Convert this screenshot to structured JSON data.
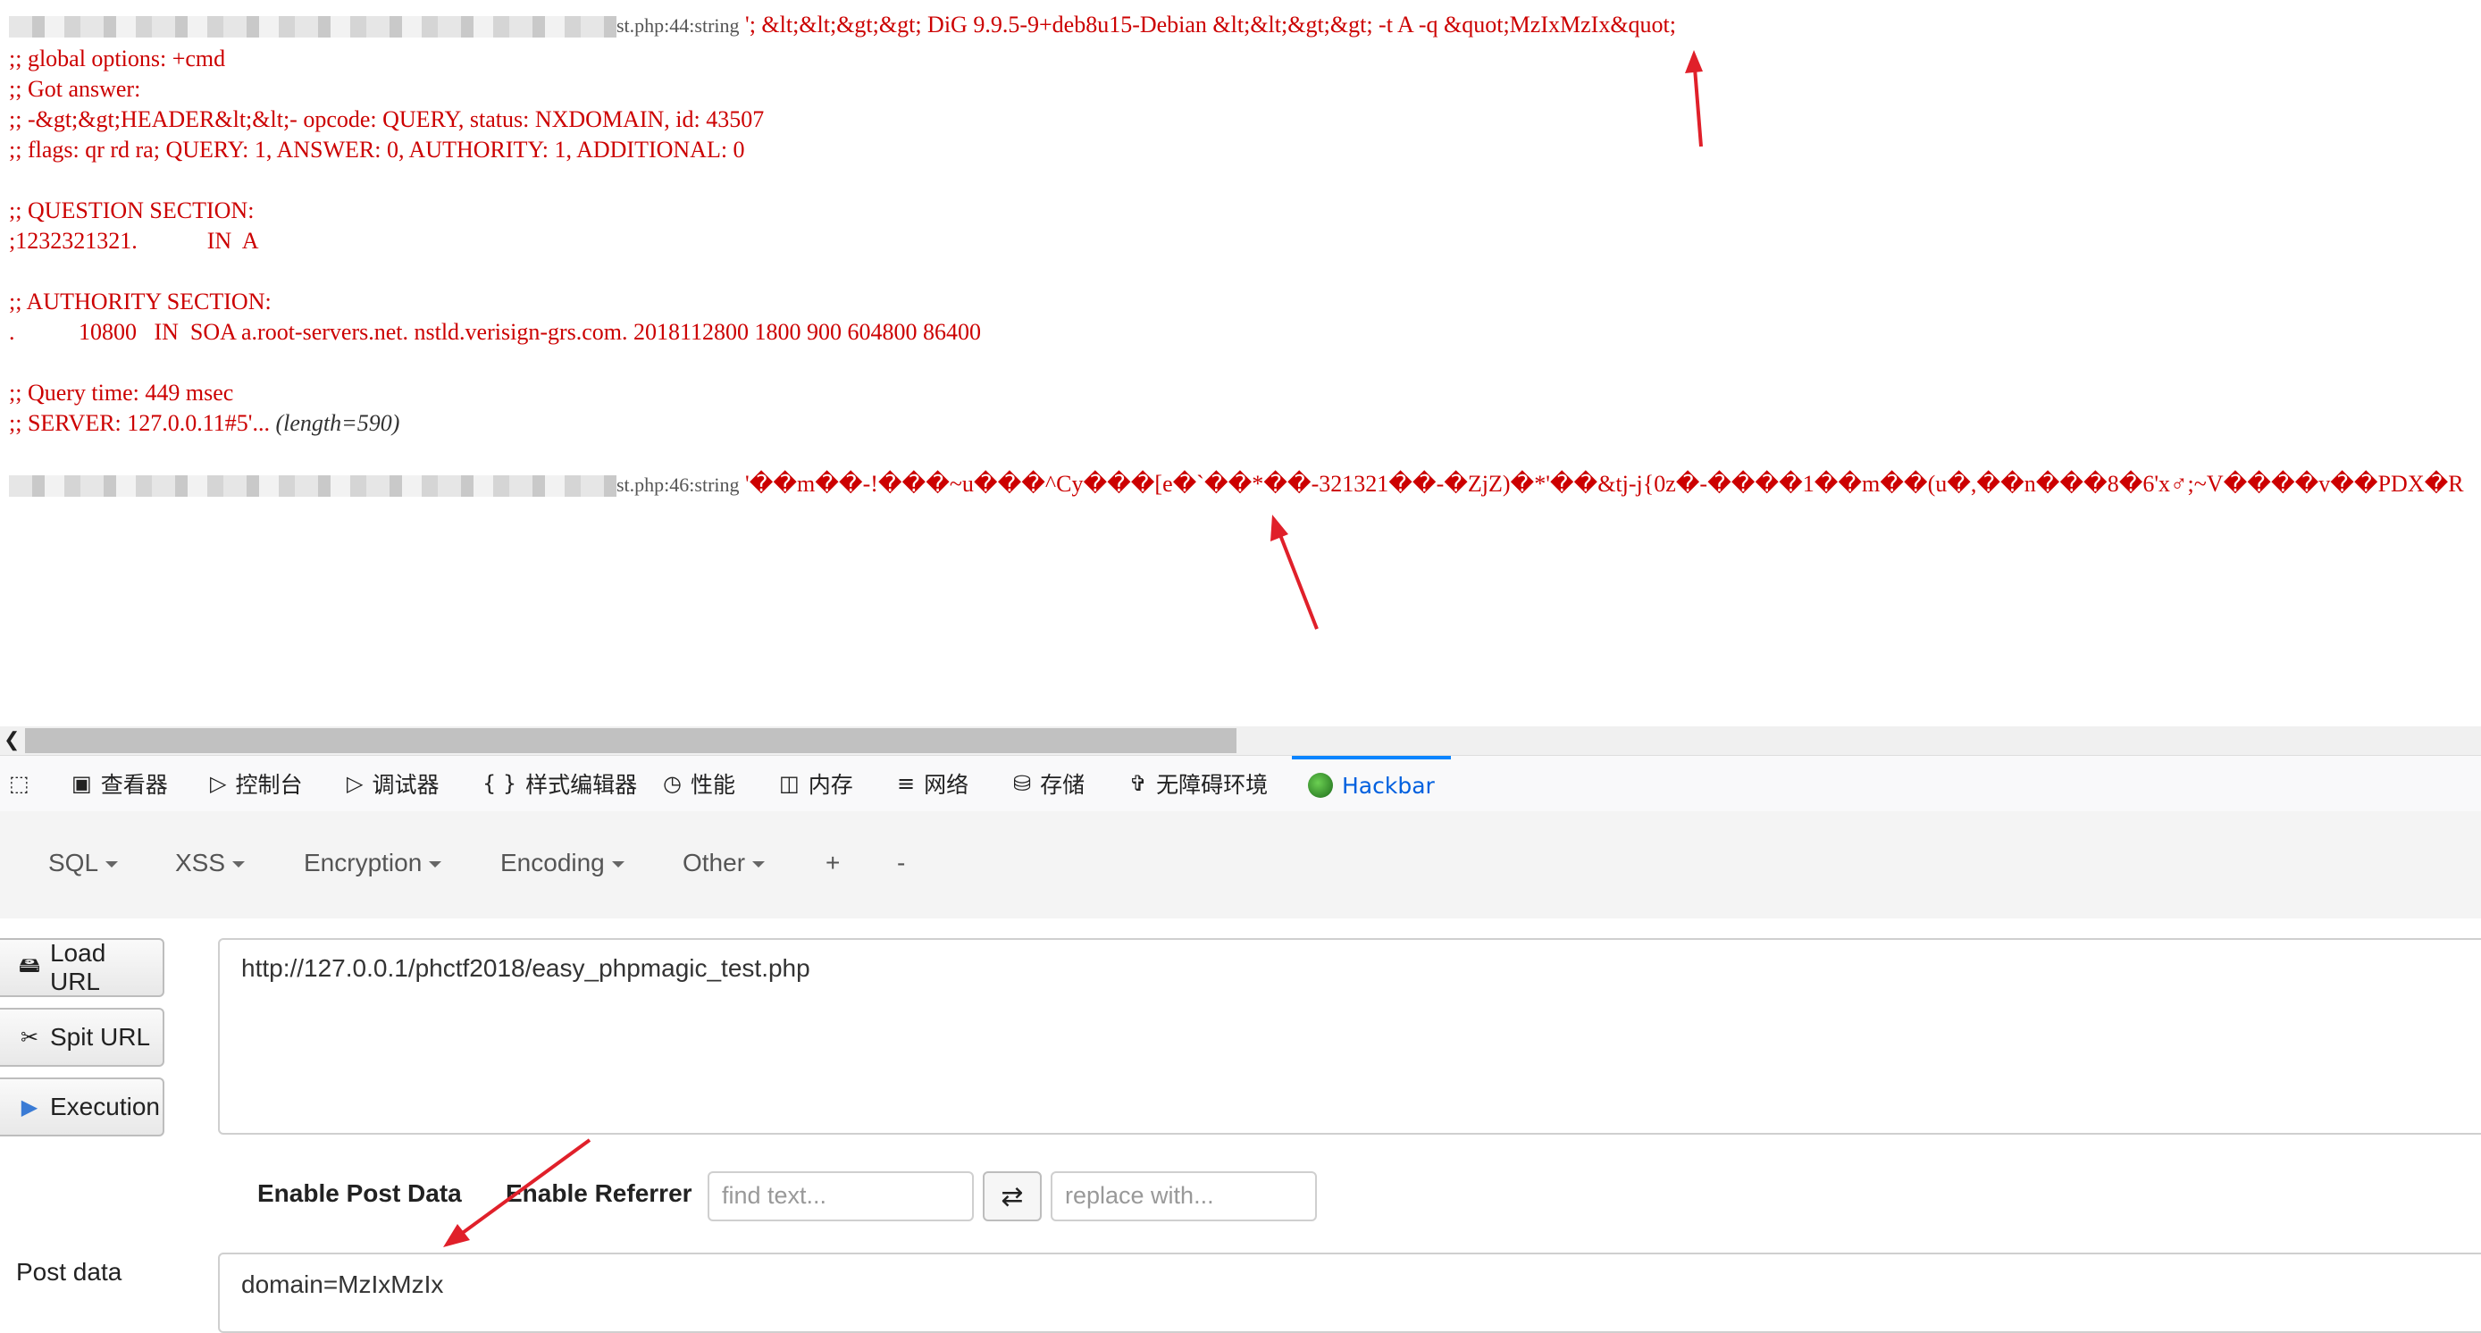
{
  "output": {
    "line1_file": "st.php:44:string",
    "line1_value": "'; &lt;&lt;&gt;&gt; DiG 9.9.5-9+deb8u15-Debian &lt;&lt;&gt;&gt; -t A -q &quot;MzIxMzIx&quot;",
    "line2": ";; global options: +cmd",
    "line3": ";; Got answer:",
    "line4": ";; -&gt;&gt;HEADER&lt;&lt;- opcode: QUERY, status: NXDOMAIN, id: 43507",
    "line5": ";; flags: qr rd ra; QUERY: 1, ANSWER: 0, AUTHORITY: 1, ADDITIONAL: 0",
    "line6": ";; QUESTION SECTION:",
    "line7": ";1232321321.            IN  A",
    "line8": ";; AUTHORITY SECTION:",
    "line9": ".           10800   IN  SOA a.root-servers.net. nstld.verisign-grs.com. 2018112800 1800 900 604800 86400",
    "line10": ";; Query time: 449 msec",
    "line11_a": ";; SERVER: 127.0.0.11#5'...",
    "line11_b": "(length=590)",
    "line12_file": "st.php:46:string",
    "line12_value": "'��m��-!���~u���^Cy���[e�`��*��-321321��-�ZjZ)�*'��&tj-j{0z�-����1��m��(u�,��n���8�6'x♂;~V����v��PDX�R"
  },
  "devtools": {
    "tabs": [
      "查看器",
      "控制台",
      "调试器",
      "样式编辑器",
      "性能",
      "内存",
      "网络",
      "存储",
      "无障碍环境",
      "Hackbar"
    ],
    "active_tab": "Hackbar"
  },
  "hackbar": {
    "menu": [
      "SQL",
      "XSS",
      "Encryption",
      "Encoding",
      "Other",
      "+",
      "-"
    ],
    "load_url": "Load URL",
    "split_url": "Spit URL",
    "execution": "Execution",
    "url_value": "http://127.0.0.1/phctf2018/easy_phpmagic_test.php",
    "enable_post": "Enable Post Data",
    "enable_referrer": "Enable Referrer",
    "find_placeholder": "find text...",
    "replace_placeholder": "replace with...",
    "post_label": "Post data",
    "post_value": "domain=MzIxMzIx"
  },
  "colors": {
    "output_text": "#cc0000",
    "active_tab": "#0060df",
    "arrow": "#e0202a"
  }
}
